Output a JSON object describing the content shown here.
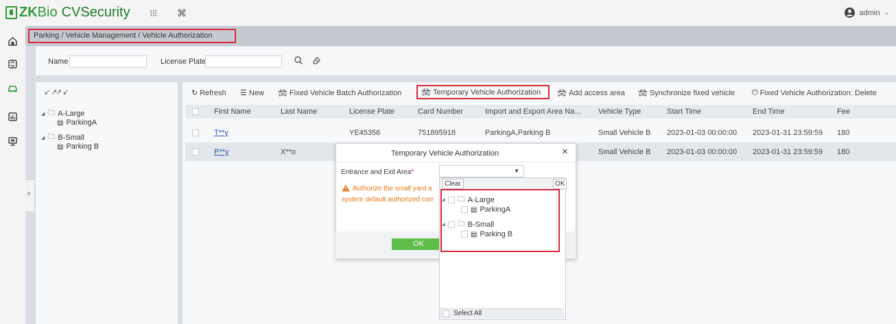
{
  "app": {
    "brand_zk": "ZK",
    "brand_bio": "Bio",
    "brand_cv": "CVSecurity",
    "grid_glyph": "⁝⁝⁝",
    "cmd_glyph": "⌘",
    "user": "admin"
  },
  "nav": {
    "icons": [
      "access-control-icon",
      "elevator-icon",
      "parking-icon",
      "report-icon",
      "monitor-icon"
    ]
  },
  "breadcrumb": "Parking / Vehicle Management / Vehicle Authorization",
  "search": {
    "name_label": "Name",
    "plate_label": "License Plate"
  },
  "tree": {
    "a_large": "A-Large",
    "parking_a": "ParkingA",
    "b_small": "B-Small",
    "parking_b": "Parking B"
  },
  "toolbar": {
    "refresh": "Refresh",
    "new": "New",
    "batch": "Fixed Vehicle Batch Authorization",
    "temporary": "Temporary Vehicle Authorization",
    "add_area": "Add access area",
    "sync": "Synchronize fixed vehicle",
    "delete": "Fixed Vehicle Authorization: Delete"
  },
  "table": {
    "headers": [
      "First Name",
      "Last Name",
      "License Plate",
      "Card Number",
      "Import and Export Area Na...",
      "Vehicle Type",
      "Start Time",
      "End Time",
      "Fee"
    ],
    "rows": [
      [
        "T**y",
        "",
        "YE45356",
        "751895918",
        "ParkingA,Parking B",
        "Small Vehicle B",
        "2023-01-03 00:00:00",
        "2023-01-31 23:59:59",
        "180"
      ],
      [
        "P**y",
        "X**o",
        "",
        "",
        "",
        "Small Vehicle B",
        "2023-01-03 00:00:00",
        "2023-01-31 23:59:59",
        "180"
      ]
    ]
  },
  "dialog": {
    "title": "Temporary Vehicle Authorization",
    "close": "×",
    "field_label": "Entrance and Exit Area",
    "required_mark": "*",
    "warning_line1": "Authorize the small yard a",
    "warning_line2": "system default authorized corr",
    "ok": "OK"
  },
  "dropdown": {
    "clear": "Clear",
    "ok": "OK",
    "a_large": "A-Large",
    "parking_a": "ParkingA",
    "b_small": "B-Small",
    "parking_b": "Parking B",
    "select_all": "Select All"
  },
  "colors": {
    "brand": "#2e9a35",
    "highlight": "#d9263b",
    "ok_button": "#5fbd4a",
    "warning": "#e8740f"
  }
}
